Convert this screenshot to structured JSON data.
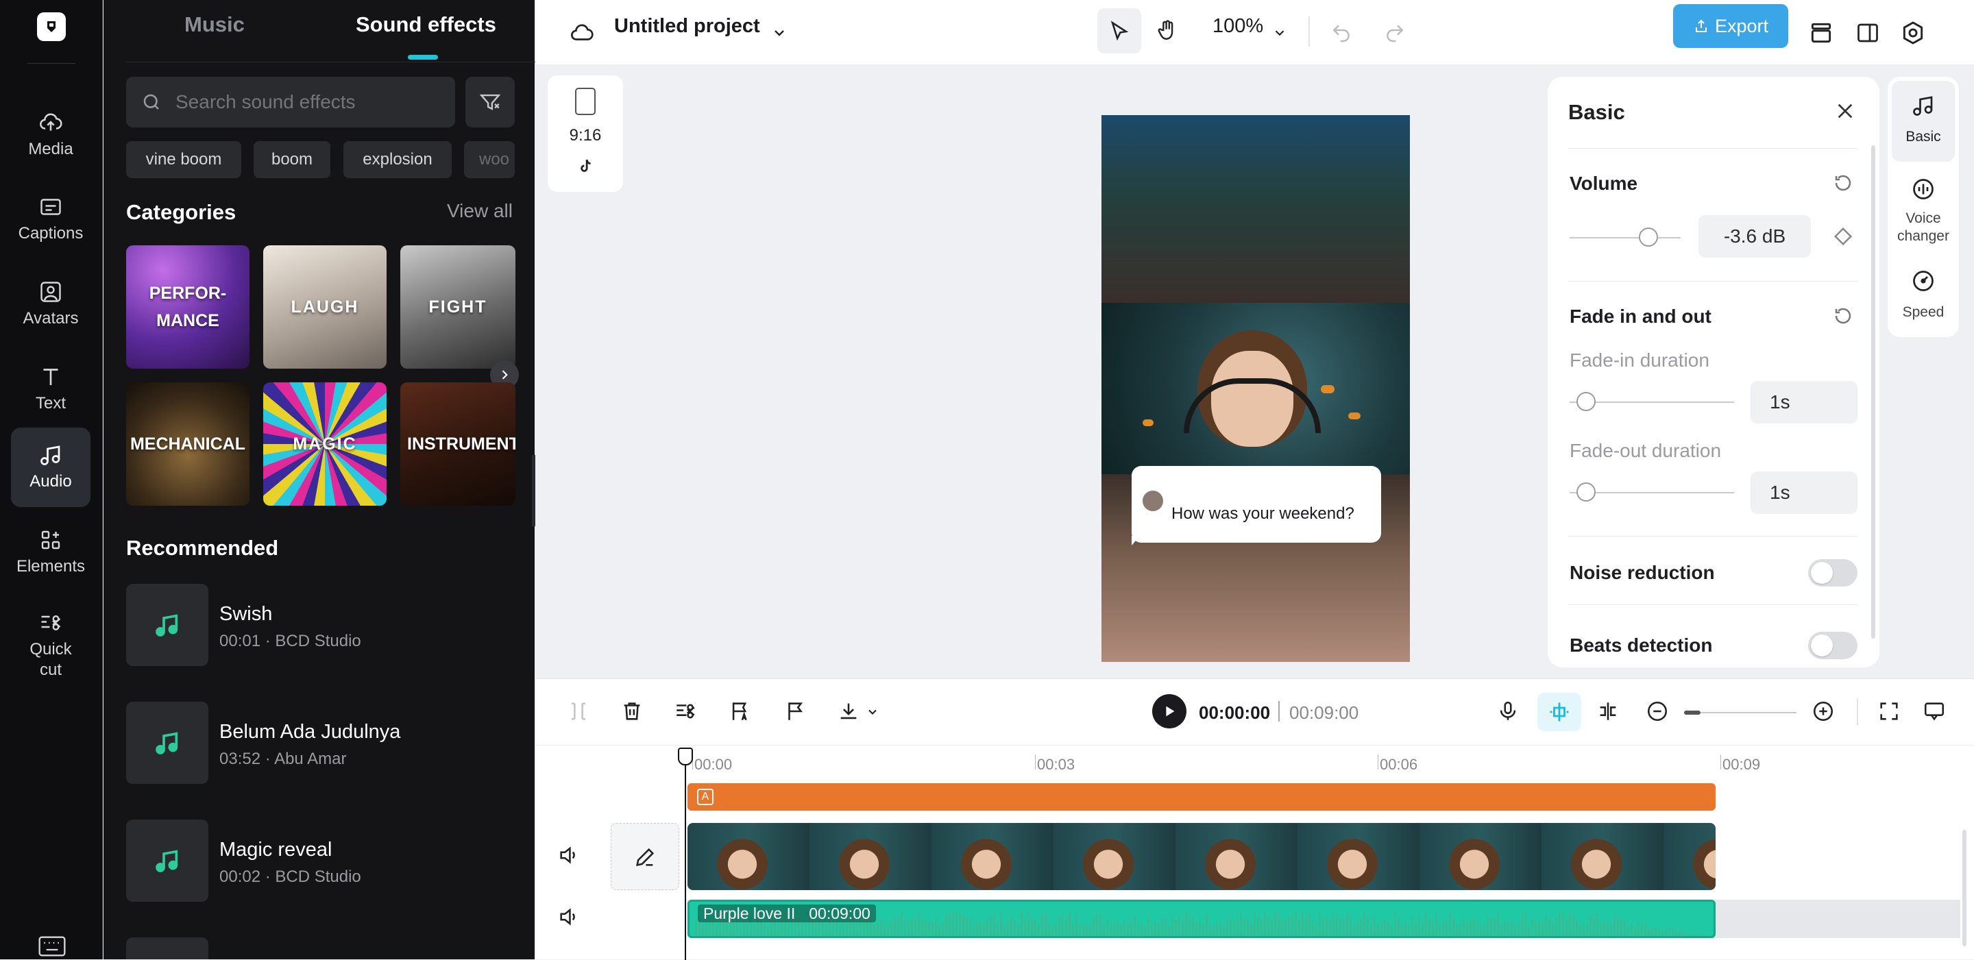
{
  "rail": {
    "items": [
      {
        "label": "Media",
        "icon": "cloud-upload-icon"
      },
      {
        "label": "Captions",
        "icon": "captions-icon"
      },
      {
        "label": "Avatars",
        "icon": "avatar-icon"
      },
      {
        "label": "Text",
        "icon": "text-icon"
      },
      {
        "label": "Audio",
        "icon": "audio-icon"
      },
      {
        "label": "Elements",
        "icon": "elements-icon"
      },
      {
        "label": "Quick\ncut",
        "icon": "quick-cut-icon"
      }
    ]
  },
  "panel": {
    "tabs": {
      "music": "Music",
      "sound_effects": "Sound effects"
    },
    "search": {
      "placeholder": "Search sound effects"
    },
    "chips": [
      "vine boom",
      "boom",
      "explosion",
      "woo"
    ],
    "categories_title": "Categories",
    "view_all": "View all",
    "categories": [
      "PERFOR-\nMANCE",
      "LAUGH",
      "FIGHT",
      "MECHANICAL",
      "MAGIC",
      "INSTRUMENT"
    ],
    "recommended_title": "Recommended",
    "recommended": [
      {
        "title": "Swish",
        "sub": "00:01 · BCD Studio"
      },
      {
        "title": "Belum Ada Judulnya",
        "sub": "03:52 · Abu Amar"
      },
      {
        "title": "Magic reveal",
        "sub": "00:02 · BCD Studio"
      }
    ]
  },
  "topbar": {
    "project": "Untitled project",
    "zoom": "100%",
    "export": "Export"
  },
  "aspect": {
    "ratio": "9:16"
  },
  "bubble": {
    "text": "How was your weekend?"
  },
  "basic": {
    "title": "Basic",
    "volume": {
      "label": "Volume",
      "value": "-3.6 dB",
      "level": 0.71
    },
    "fade": {
      "label": "Fade in and out",
      "in_label": "Fade-in duration",
      "in_value": "1s",
      "out_label": "Fade-out duration",
      "out_value": "1s"
    },
    "noise": "Noise reduction",
    "beats": "Beats detection"
  },
  "sidetabs": [
    {
      "label": "Basic",
      "icon": "music-note-icon"
    },
    {
      "label": "Voice\nchanger",
      "icon": "voice-changer-icon"
    },
    {
      "label": "Speed",
      "icon": "speed-icon"
    }
  ],
  "timeline": {
    "current": "00:00:00",
    "total": "00:09:00",
    "ticks": [
      "00:00",
      "00:03",
      "00:06",
      "00:09"
    ],
    "audio_clip": {
      "name": "Purple love II",
      "duration": "00:09:00"
    }
  },
  "colors": {
    "accent": "#3aa6e8",
    "teal": "#1fc9a6",
    "orange": "#e8762b"
  }
}
